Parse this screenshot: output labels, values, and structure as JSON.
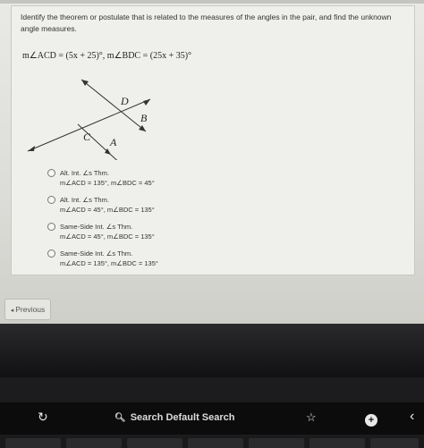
{
  "question": {
    "prompt": "Identify the theorem or postulate that is related to the measures of the angles in the pair, and find the unknown angle measures.",
    "equation": "m∠ACD = (5x + 25)°, m∠BDC = (25x + 35)°",
    "figure_labels": {
      "d": "D",
      "b": "B",
      "c": "C",
      "a": "A"
    }
  },
  "options": [
    {
      "line1": "Alt. Int. ∠s Thm.",
      "line2": "m∠ACD = 135°, m∠BDC = 45°"
    },
    {
      "line1": "Alt. Int. ∠s Thm.",
      "line2": "m∠ACD = 45°, m∠BDC = 135°"
    },
    {
      "line1": "Same-Side Int. ∠s Thm.",
      "line2": "m∠ACD = 45°, m∠BDC = 135°"
    },
    {
      "line1": "Same-Side Int. ∠s Thm.",
      "line2": "m∠ACD = 135°, m∠BDC = 135°"
    }
  ],
  "nav": {
    "previous_label": "Previous"
  },
  "touchbar": {
    "search_label": "Search Default Search"
  }
}
